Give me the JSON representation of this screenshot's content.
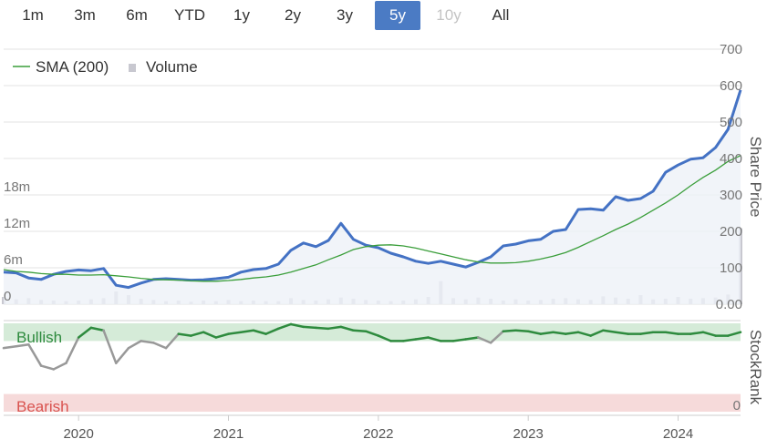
{
  "range_buttons": [
    {
      "label": "1m",
      "state": "normal"
    },
    {
      "label": "3m",
      "state": "normal"
    },
    {
      "label": "6m",
      "state": "normal"
    },
    {
      "label": "YTD",
      "state": "normal"
    },
    {
      "label": "1y",
      "state": "normal"
    },
    {
      "label": "2y",
      "state": "normal"
    },
    {
      "label": "3y",
      "state": "normal"
    },
    {
      "label": "5y",
      "state": "active"
    },
    {
      "label": "10y",
      "state": "disabled"
    },
    {
      "label": "All",
      "state": "normal"
    }
  ],
  "colors": {
    "price": "#4472c4",
    "sma": "#3a9e3a",
    "volume": "#c8c8d0",
    "price_area": "#eef1f8",
    "stockrank": "#2e8b3e",
    "stockrank_low": "#999999",
    "bullish_band": "#d5ebd8",
    "bearish_band": "#f6dada",
    "bullish_text": "#2e8b3e",
    "bearish_text": "#d9534f",
    "active_button": "#4b7bc4"
  },
  "chart_data": [
    {
      "type": "line",
      "legend": {
        "placement": "top-left",
        "items": [
          "SMA (200)",
          "Volume"
        ]
      },
      "x": [
        "2019-07",
        "2019-08",
        "2019-09",
        "2019-10",
        "2019-11",
        "2019-12",
        "2020-01",
        "2020-02",
        "2020-03",
        "2020-04",
        "2020-05",
        "2020-06",
        "2020-07",
        "2020-08",
        "2020-09",
        "2020-10",
        "2020-11",
        "2020-12",
        "2021-01",
        "2021-02",
        "2021-03",
        "2021-04",
        "2021-05",
        "2021-06",
        "2021-07",
        "2021-08",
        "2021-09",
        "2021-10",
        "2021-11",
        "2021-12",
        "2022-01",
        "2022-02",
        "2022-03",
        "2022-04",
        "2022-05",
        "2022-06",
        "2022-07",
        "2022-08",
        "2022-09",
        "2022-10",
        "2022-11",
        "2022-12",
        "2023-01",
        "2023-02",
        "2023-03",
        "2023-04",
        "2023-05",
        "2023-06",
        "2023-07",
        "2023-08",
        "2023-09",
        "2023-10",
        "2023-11",
        "2023-12",
        "2024-01",
        "2024-02",
        "2024-03",
        "2024-04",
        "2024-05",
        "2024-06"
      ],
      "x_tick_labels": [
        "2020",
        "2021",
        "2022",
        "2023",
        "2024"
      ],
      "series": [
        {
          "role": "price",
          "values": [
            88,
            86,
            72,
            68,
            82,
            90,
            94,
            92,
            98,
            52,
            46,
            58,
            68,
            70,
            68,
            66,
            67,
            70,
            74,
            88,
            95,
            98,
            110,
            148,
            168,
            158,
            175,
            222,
            178,
            162,
            155,
            140,
            130,
            118,
            112,
            118,
            110,
            102,
            115,
            130,
            160,
            165,
            174,
            178,
            200,
            205,
            260,
            262,
            258,
            295,
            285,
            290,
            310,
            362,
            382,
            398,
            402,
            430,
            480,
            588
          ]
        },
        {
          "role": "sma",
          "name": "SMA (200)",
          "values": [
            95,
            90,
            88,
            84,
            82,
            82,
            80,
            80,
            81,
            78,
            75,
            71,
            68,
            67,
            66,
            64,
            63,
            63,
            65,
            68,
            72,
            75,
            80,
            88,
            98,
            108,
            122,
            135,
            150,
            158,
            162,
            163,
            160,
            154,
            146,
            138,
            130,
            122,
            116,
            113,
            113,
            114,
            118,
            124,
            132,
            142,
            156,
            172,
            188,
            205,
            220,
            238,
            258,
            278,
            300,
            325,
            348,
            368,
            392,
            408
          ]
        },
        {
          "role": "volume",
          "name": "Volume",
          "values": [
            1.2,
            0.8,
            1.0,
            0.7,
            0.6,
            0.5,
            0.6,
            0.8,
            1.0,
            2.1,
            1.5,
            0.9,
            0.7,
            0.5,
            0.6,
            0.4,
            0.6,
            0.5,
            0.7,
            0.5,
            0.6,
            0.5,
            0.5,
            1.0,
            0.7,
            0.6,
            0.8,
            1.1,
            0.9,
            0.7,
            0.6,
            0.5,
            0.6,
            0.8,
            1.2,
            3.8,
            1.0,
            0.8,
            1.1,
            0.9,
            0.6,
            0.8,
            0.6,
            0.7,
            0.9,
            1.0,
            0.8,
            0.7,
            1.3,
            1.1,
            0.9,
            1.5,
            0.8,
            0.9,
            1.2,
            0.9,
            1.0,
            1.1,
            1.6,
            12.5
          ]
        }
      ],
      "y_right": {
        "label": "Share Price",
        "ticks": [
          "0.00",
          "100",
          "200",
          "300",
          "400",
          "500",
          "600",
          "700"
        ],
        "ylim": [
          0,
          700
        ]
      },
      "y_left": {
        "ticks": [
          "0",
          "6m",
          "12m",
          "18m"
        ],
        "ylim": [
          0,
          18
        ]
      },
      "grid": true
    },
    {
      "type": "line",
      "title": "",
      "bands": [
        {
          "label": "Bullish",
          "range": [
            80,
            100
          ]
        },
        {
          "label": "Bearish",
          "range": [
            0,
            20
          ]
        }
      ],
      "y_right": {
        "label": "StockRank",
        "ticks": [
          "0"
        ],
        "ylim": [
          0,
          100
        ]
      },
      "series": [
        {
          "role": "stockrank",
          "values": [
            72,
            74,
            76,
            52,
            48,
            55,
            84,
            95,
            92,
            55,
            72,
            80,
            78,
            72,
            88,
            86,
            90,
            84,
            88,
            90,
            92,
            88,
            94,
            99,
            96,
            95,
            94,
            96,
            92,
            91,
            86,
            80,
            80,
            82,
            84,
            80,
            80,
            82,
            84,
            78,
            91,
            92,
            91,
            88,
            90,
            88,
            90,
            86,
            92,
            90,
            88,
            88,
            90,
            90,
            88,
            88,
            90,
            86,
            86,
            90
          ]
        }
      ]
    }
  ]
}
